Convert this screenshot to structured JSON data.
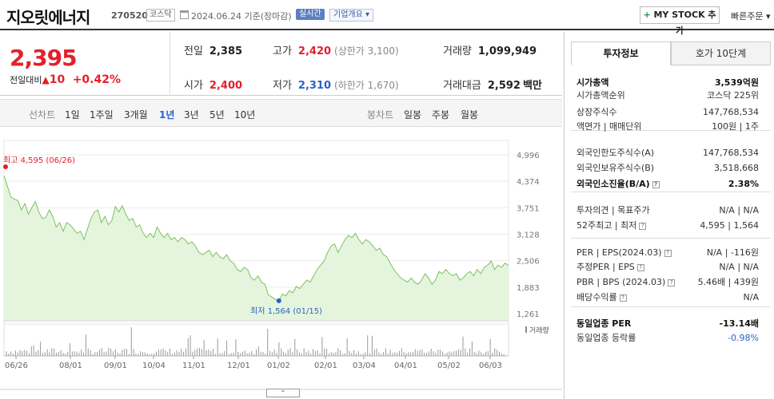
{
  "header": {
    "company": "지오릿에너지",
    "code": "270520",
    "market": "코스닥",
    "date": "2024.06.24  기준(장마감)",
    "realtime": "실시간",
    "company_info": "기업개요 ▾",
    "mystock_plus": "+",
    "mystock": " MY STOCK 추가",
    "quick_order": "빠른주문 ▾"
  },
  "summary": {
    "price": "2,395",
    "change_label": "전일대비",
    "change_value": "10",
    "change_pct": "+0.42%",
    "prev_label": "전일",
    "prev": "2,385",
    "high_label": "고가",
    "high": "2,420",
    "upper_limit": "(상한가 3,100)",
    "volume_label": "거래량",
    "volume": "1,099,949",
    "open_label": "시가",
    "open": "2,400",
    "low_label": "저가",
    "low": "2,310",
    "lower_limit": "(하한가 1,670)",
    "amount_label": "거래대금",
    "amount": "2,592",
    "amount_unit": "백만"
  },
  "period_bar": {
    "line_chart": "선차트",
    "periods": [
      "1일",
      "1주일",
      "3개월",
      "1년",
      "3년",
      "5년",
      "10년"
    ],
    "active": "1년",
    "candle_chart": "봉차트",
    "candles": [
      "일봉",
      "주봉",
      "월봉"
    ]
  },
  "side": {
    "tab_invest": "투자정보",
    "tab_orderbook": "호가 10단계",
    "rows": [
      {
        "l": "시가총액",
        "r": "3,539억원"
      },
      {
        "l": "시가총액순위",
        "r": "코스닥 225위"
      },
      {
        "l": "상장주식수",
        "r": "147,768,534"
      },
      {
        "l": "액면가 | 매매단위",
        "r": "100원 | 1주"
      },
      {
        "l": "외국인한도주식수(A)",
        "r": "147,768,534"
      },
      {
        "l": "외국인보유주식수(B)",
        "r": "3,518,668"
      },
      {
        "l": "외국인소진율(B/A)",
        "r": "2.38%"
      },
      {
        "l": "투자의견 | 목표주가",
        "r": "N/A | N/A"
      },
      {
        "l": "52주최고 | 최저",
        "r": "4,595 | 1,564"
      },
      {
        "l": "PER | EPS(2024.03)",
        "r": "N/A | -116원"
      },
      {
        "l": "추정PER | EPS",
        "r": "N/A | N/A"
      },
      {
        "l": "PBR | BPS (2024.03)",
        "r": "5.46배 | 439원"
      },
      {
        "l": "배당수익률",
        "r": "N/A"
      },
      {
        "l": "동일업종 PER",
        "r": "-13.14배"
      },
      {
        "l": "동일업종 등락률",
        "r": "-0.98%"
      }
    ]
  },
  "chart_data": {
    "type": "area",
    "y_ticks": [
      "4,996",
      "4,374",
      "3,751",
      "3,128",
      "2,506",
      "1,883",
      "1,261"
    ],
    "ylim": [
      1261,
      4996
    ],
    "x_ticks": [
      "06/26",
      "08/01",
      "09/01",
      "10/04",
      "11/01",
      "12/01",
      "01/02",
      "02/01",
      "03/04",
      "04/01",
      "05/02",
      "06/03"
    ],
    "high_label": "최고 4,595 (06/26)",
    "low_label": "최저 1,564 (01/15)",
    "volume_label": "거래량",
    "series": [
      {
        "values": [
          4500,
          4250,
          4000,
          3950,
          3920,
          3700,
          3850,
          3600,
          3750,
          3900,
          3650,
          3500,
          3520,
          3700,
          3550,
          3300,
          3400,
          3200,
          3400,
          3350,
          3250,
          3150,
          3200,
          3000,
          3250,
          3500,
          3650,
          3700,
          3400,
          3550,
          3350,
          3450,
          3780,
          3650,
          3800,
          3600,
          3450,
          3500,
          3300,
          3350,
          3150,
          3050,
          3150,
          3050,
          3300,
          3150,
          3050,
          3150,
          3000,
          3050,
          2950,
          3050,
          3000,
          2900,
          2950,
          2850,
          2700,
          2650,
          2700,
          2750,
          2600,
          2700,
          2600,
          2550,
          2650,
          2500,
          2450,
          2300,
          2250,
          2350,
          2300,
          2100,
          2050,
          2150,
          2000,
          1950,
          1700,
          1650,
          1600,
          1564,
          1720,
          1680,
          1800,
          1750,
          1900,
          1850,
          1950,
          2050,
          2000,
          2150,
          2300,
          2400,
          2500,
          2700,
          2850,
          2900,
          2700,
          2850,
          3000,
          3100,
          3050,
          3150,
          3000,
          2900,
          3000,
          2950,
          2850,
          2750,
          2800,
          2650,
          2600,
          2450,
          2300,
          2200,
          2100,
          2050,
          2000,
          2100,
          2000,
          1950,
          2050,
          2200,
          2100,
          1950,
          2050,
          2250,
          2200,
          2300,
          2200,
          2150,
          2200,
          2050,
          2100,
          2200,
          2250,
          2150,
          2300,
          2200,
          2350,
          2400,
          2500,
          2300,
          2400,
          2350,
          2450,
          2395
        ]
      }
    ]
  }
}
